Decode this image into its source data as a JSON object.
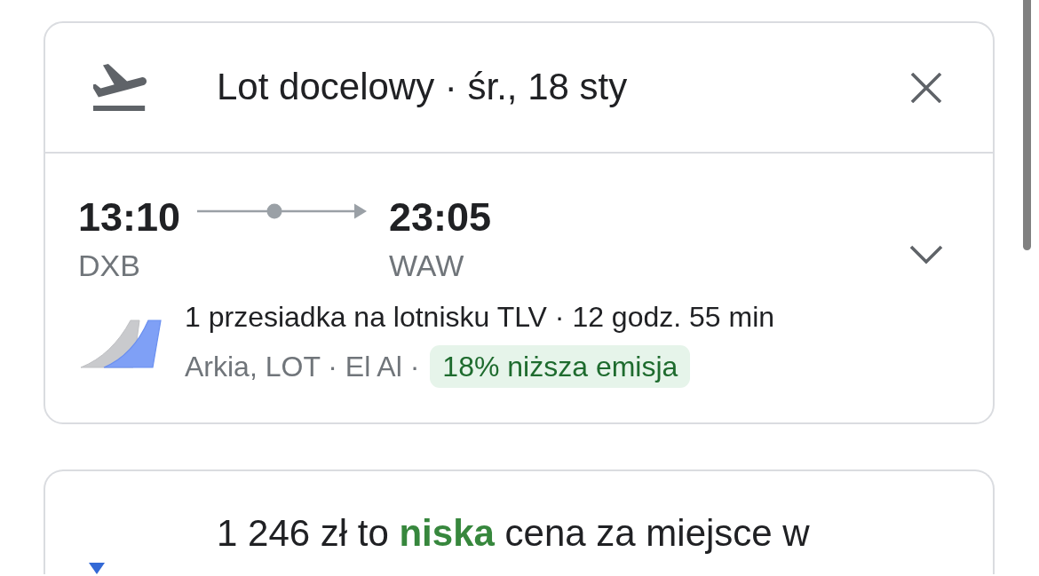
{
  "header": {
    "title": "Lot docelowy · śr., 18 sty"
  },
  "flight": {
    "departure": {
      "time": "13:10",
      "airport": "DXB"
    },
    "arrival": {
      "time": "23:05",
      "airport": "WAW"
    },
    "expanded": false,
    "stops": "1 przesiadka na lotnisku TLV · 12 godz. 55 min",
    "airlines": "Arkia, LOT · El Al ·",
    "emissions_badge": "18% niższa emisja"
  },
  "price_insight": {
    "text": "1 246 zł to **niska** cena za miejsce w"
  }
}
